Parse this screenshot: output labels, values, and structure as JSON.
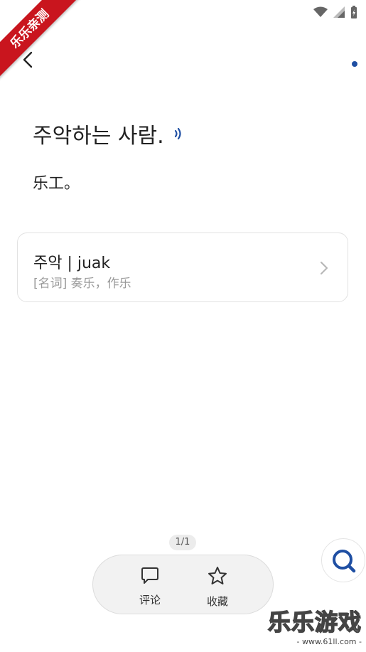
{
  "ribbon": {
    "label": "乐乐亲测"
  },
  "entry": {
    "sentence": "주악하는 사람.",
    "translation": "乐工。"
  },
  "word_card": {
    "word": "주악 | juak",
    "definition": "[名词] 奏乐，作乐"
  },
  "pager": {
    "text": "1/1"
  },
  "actions": {
    "comment_label": "评论",
    "favorite_label": "收藏"
  },
  "watermark": {
    "main": "乐乐游戏",
    "sub": "- www.61ll.com -"
  },
  "colors": {
    "accent": "#1f4fa3",
    "ribbon": "#c9151e"
  },
  "icons": [
    "back-arrow-icon",
    "menu-dot-icon",
    "sound-icon",
    "chevron-right-icon",
    "comment-icon",
    "star-icon",
    "search-icon",
    "wifi-icon",
    "signal-icon",
    "battery-icon"
  ]
}
